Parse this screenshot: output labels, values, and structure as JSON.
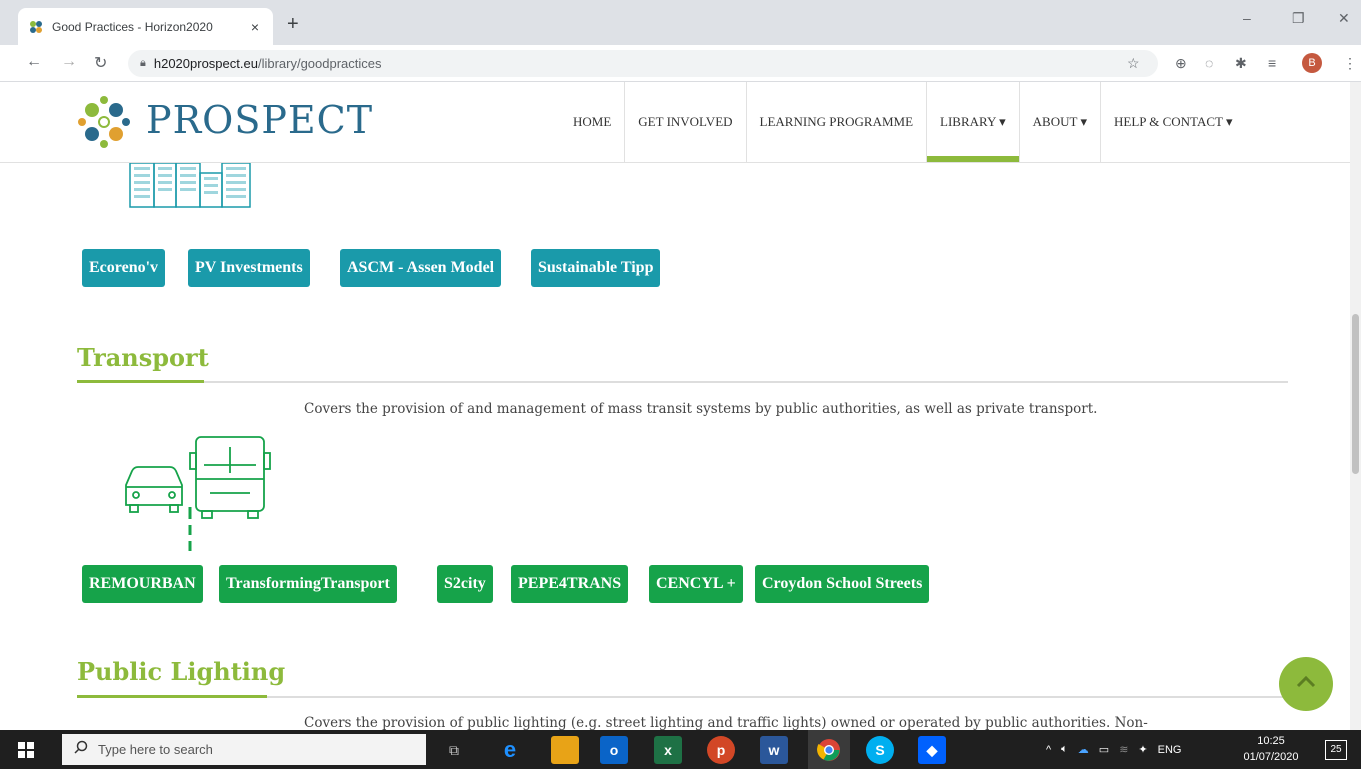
{
  "browser": {
    "tab_title": "Good Practices - Horizon2020",
    "tab_close": "×",
    "new_tab": "+",
    "url_host": "h2020prospect.eu",
    "url_path": "/library/goodpractices",
    "profile_initial": "B",
    "window_minimize": "–",
    "window_restore": "❐",
    "window_close": "✕"
  },
  "site": {
    "logo_text": "PROSPECT",
    "nav": [
      {
        "label": "HOME"
      },
      {
        "label": "GET INVOLVED"
      },
      {
        "label": "LEARNING PROGRAMME"
      },
      {
        "label": "LIBRARY ▾",
        "active": true
      },
      {
        "label": "ABOUT ▾"
      },
      {
        "label": "HELP & CONTACT ▾"
      }
    ]
  },
  "buildings_section": {
    "buttons": [
      "Ecoreno'v",
      "PV Investments",
      "ASCM - Assen Model",
      "Sustainable Tipp"
    ],
    "color": "#1a9aaa"
  },
  "transport_section": {
    "title": "Transport",
    "description": "Covers the provision of and management of mass transit systems by public authorities, as well as private transport.",
    "buttons": [
      "REMOURBAN",
      "TransformingTransport",
      "S2city",
      "PEPE4TRANS",
      "CENCYL +",
      "Croydon School Streets"
    ],
    "color": "#16a34a"
  },
  "lighting_section": {
    "title": "Public Lighting",
    "description": "Covers the provision of public lighting (e.g. street lighting and traffic lights) owned or operated by public authorities. Non-"
  },
  "taskbar": {
    "search_placeholder": "Type here to search",
    "lang": "ENG",
    "time": "10:25",
    "date": "01/07/2020",
    "notification_count": "25"
  },
  "colors": {
    "accent_green": "#8dba3c",
    "logo_blue": "#2a6a8c"
  }
}
